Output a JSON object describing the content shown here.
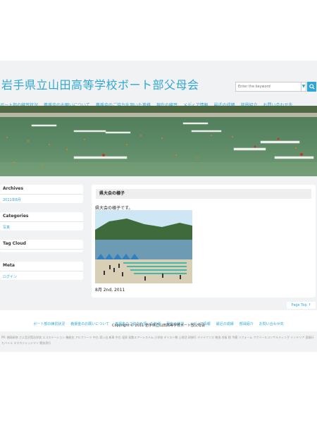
{
  "site": {
    "title": "岩手県立山田高等学校ボート部父母会"
  },
  "search": {
    "placeholder": "Enter the keyword",
    "dropdown_icon": "chevron-down-icon",
    "button_icon": "search-icon"
  },
  "nav": [
    "ボート部の練習状況",
    "義援金のお願いについて",
    "義援金のご協力を頂いた皆様",
    "現在の練習",
    "メディア情報",
    "最近の成績",
    "部員紹介",
    "お問い合わせ先"
  ],
  "sidebar": {
    "archives": {
      "heading": "Archives",
      "items": [
        "2011年8月"
      ]
    },
    "categories": {
      "heading": "Categories",
      "items": [
        "写真"
      ]
    },
    "tagcloud": {
      "heading": "Tag Cloud"
    },
    "meta": {
      "heading": "Meta",
      "items": [
        "ログイン"
      ]
    }
  },
  "post": {
    "title": "県大会の様子",
    "body": "県大会の様子です。",
    "date": "8月 2nd, 2011"
  },
  "page_top": "Page Top ↑",
  "footer": {
    "nav": [
      "ボート部の練習状況",
      "義援金のお願いについて",
      "義援金のご協力を頂いた皆様",
      "現在の練習",
      "メディア情報",
      "最近の成績",
      "部員紹介",
      "お問い合わせ先"
    ],
    "copyright": "Copyright © 2011 岩手県立山田高等学校ボート部父母会"
  },
  "tags_text": "PR: 開発研修 さよ宮沢賢治学校 エコステーション 機能金 アルファード 中古 家い出 新車 中古 温泉 発散エアーシステム 小学校 キリスト教 土地活 研修行 デイテナンス 物流 合板 税 予備 リフォーム アクリールコンサルティング インテリア 面接行 モバイル スマホジャッジマン 競技用行"
}
